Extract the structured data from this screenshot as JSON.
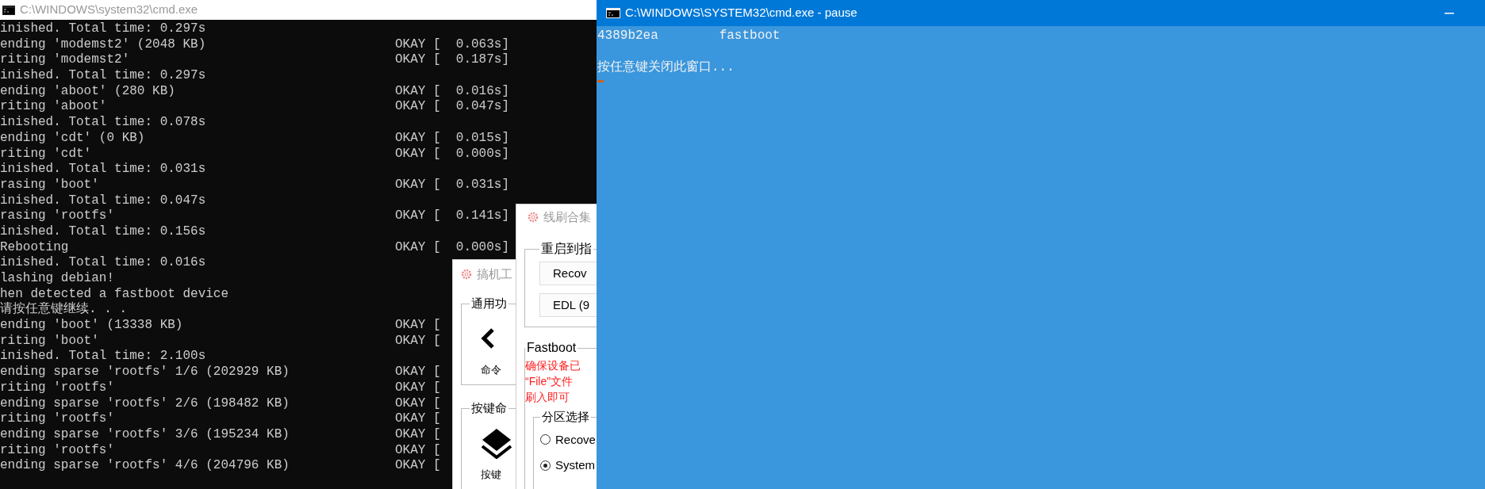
{
  "console_window": {
    "title": "C:\\WINDOWS\\system32\\cmd.exe",
    "lines": [
      {
        "text": "inished. Total time: 0.297s"
      },
      {
        "text": "ending 'modemst2' (2048 KB)",
        "status": "OKAY [  0.063s]"
      },
      {
        "text": "riting 'modemst2'",
        "status": "OKAY [  0.187s]"
      },
      {
        "text": "inished. Total time: 0.297s"
      },
      {
        "text": "ending 'aboot' (280 KB)",
        "status": "OKAY [  0.016s]"
      },
      {
        "text": "riting 'aboot'",
        "status": "OKAY [  0.047s]"
      },
      {
        "text": "inished. Total time: 0.078s"
      },
      {
        "text": "ending 'cdt' (0 KB)",
        "status": "OKAY [  0.015s]"
      },
      {
        "text": "riting 'cdt'",
        "status": "OKAY [  0.000s]"
      },
      {
        "text": "inished. Total time: 0.031s"
      },
      {
        "text": "rasing 'boot'",
        "status": "OKAY [  0.031s]"
      },
      {
        "text": "inished. Total time: 0.047s"
      },
      {
        "text": "rasing 'rootfs'",
        "status": "OKAY [  0.141s]"
      },
      {
        "text": "inished. Total time: 0.156s"
      },
      {
        "text": "Rebooting",
        "status": "OKAY [  0.000s]"
      },
      {
        "text": "inished. Total time: 0.016s"
      },
      {
        "text": "lashing debian!"
      },
      {
        "text": "hen detected a fastboot device"
      },
      {
        "text": "请按任意键继续. . ."
      },
      {
        "text": "ending 'boot' (13338 KB)",
        "status": "OKAY ["
      },
      {
        "text": "riting 'boot'",
        "status": "OKAY ["
      },
      {
        "text": "inished. Total time: 2.100s"
      },
      {
        "text": "ending sparse 'rootfs' 1/6 (202929 KB)",
        "status": "OKAY ["
      },
      {
        "text": "riting 'rootfs'",
        "status": "OKAY ["
      },
      {
        "text": "ending sparse 'rootfs' 2/6 (198482 KB)",
        "status": "OKAY ["
      },
      {
        "text": "riting 'rootfs'",
        "status": "OKAY ["
      },
      {
        "text": "ending sparse 'rootfs' 3/6 (195234 KB)",
        "status": "OKAY ["
      },
      {
        "text": "riting 'rootfs'",
        "status": "OKAY ["
      },
      {
        "text": "ending sparse 'rootfs' 4/6 (204796 KB)",
        "status": "OKAY ["
      }
    ]
  },
  "tool_window": {
    "title": "搞机工",
    "groups": [
      {
        "label": "通用功",
        "tool": "命令"
      },
      {
        "label": "按键命",
        "tool": "按键"
      }
    ]
  },
  "flash_window": {
    "title": "线刷合集",
    "reboot_group": {
      "label": "重启到指",
      "buttons": [
        "Recov",
        "EDL (9"
      ]
    },
    "fastboot_group": {
      "label": "Fastboot",
      "warning": [
        "确保设备已",
        "“File”文件",
        "刷入即可"
      ],
      "partition_group": {
        "label": "分区选择",
        "options": [
          {
            "label": "Recove",
            "selected": false
          },
          {
            "label": "System",
            "selected": true
          }
        ]
      }
    }
  },
  "pause_window": {
    "title": "C:\\WINDOWS\\SYSTEM32\\cmd.exe - pause",
    "lines": [
      "4389b2ea        fastboot",
      "按任意键关闭此窗口..."
    ]
  }
}
